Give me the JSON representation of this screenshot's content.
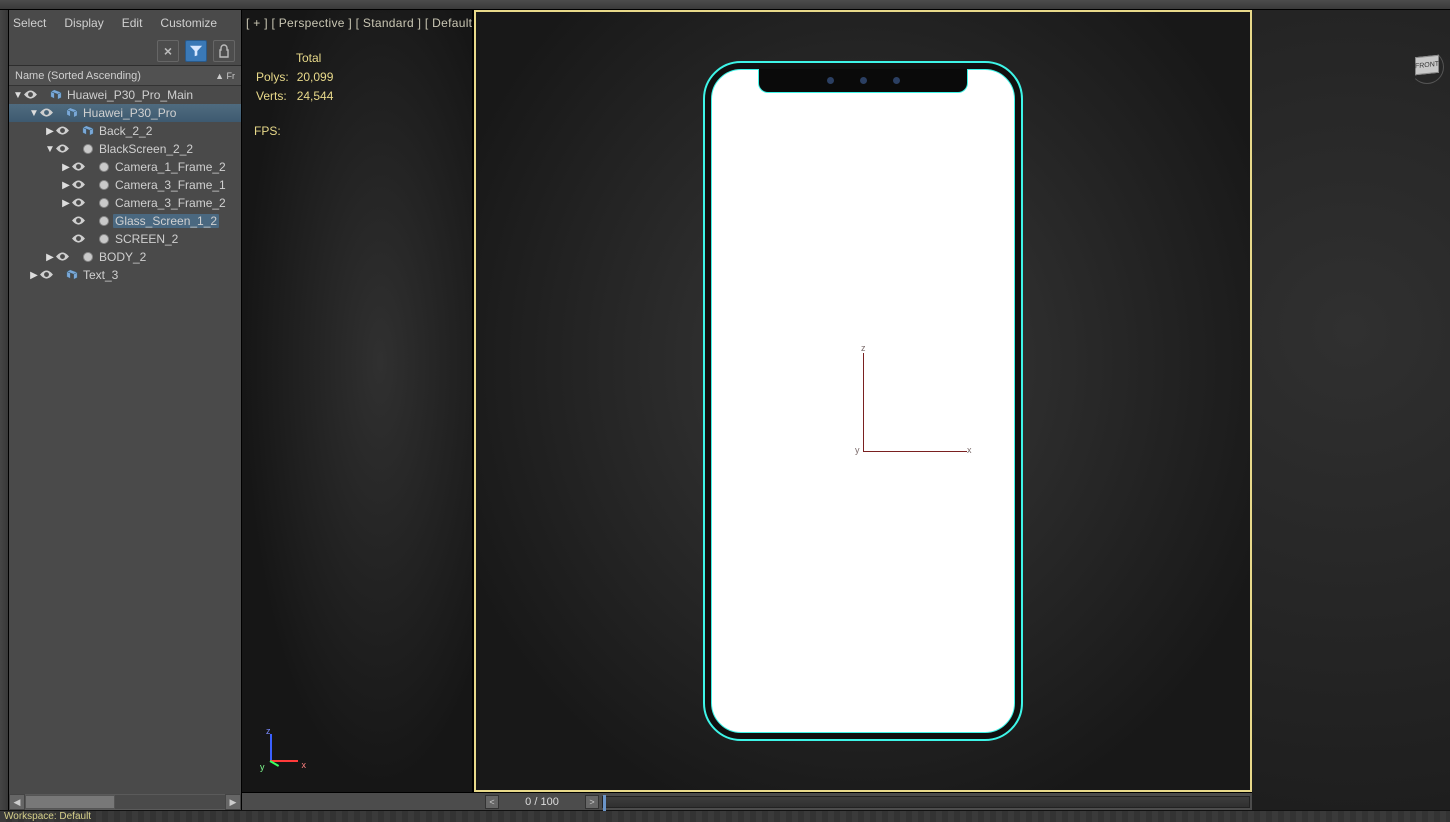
{
  "toolbar_icons": 20,
  "outliner": {
    "menus": [
      "Select",
      "Display",
      "Edit",
      "Customize"
    ],
    "header_label": "Name (Sorted Ascending)",
    "header_col2": "Fr",
    "items": [
      {
        "ind": 0,
        "tog": "▼",
        "kind": "group",
        "label": "Huawei_P30_Pro_Main",
        "sel": false
      },
      {
        "ind": 1,
        "tog": "▼",
        "kind": "group",
        "label": "Huawei_P30_Pro",
        "sel": true
      },
      {
        "ind": 2,
        "tog": "▶",
        "kind": "group",
        "label": "Back_2_2",
        "sel": false
      },
      {
        "ind": 2,
        "tog": "▼",
        "kind": "geom",
        "label": "BlackScreen_2_2",
        "sel": false
      },
      {
        "ind": 3,
        "tog": "▶",
        "kind": "geom",
        "label": "Camera_1_Frame_2",
        "sel": false
      },
      {
        "ind": 3,
        "tog": "▶",
        "kind": "geom",
        "label": "Camera_3_Frame_1",
        "sel": false
      },
      {
        "ind": 3,
        "tog": "▶",
        "kind": "geom",
        "label": "Camera_3_Frame_2",
        "sel": false
      },
      {
        "ind": 3,
        "tog": "",
        "kind": "geom",
        "label": "Glass_Screen_1_2",
        "sel": false,
        "lblsel": true
      },
      {
        "ind": 3,
        "tog": "",
        "kind": "geom",
        "label": "SCREEN_2",
        "sel": false
      },
      {
        "ind": 2,
        "tog": "▶",
        "kind": "geom",
        "label": "BODY_2",
        "sel": false
      },
      {
        "ind": 1,
        "tog": "▶",
        "kind": "group",
        "label": "Text_3",
        "sel": false
      }
    ]
  },
  "viewport": {
    "label": "[ + ] [ Perspective ] [ Standard ] [ Default Shading ]",
    "stats_header": "Total",
    "polys_label": "Polys:",
    "polys_value": "20,099",
    "verts_label": "Verts:",
    "verts_value": "24,544",
    "fps_label": "FPS:",
    "axis": {
      "x": "x",
      "y": "y",
      "z": "z"
    },
    "viewcube_face": "FRONT"
  },
  "timeline": {
    "pos": "0 / 100"
  },
  "workspace_label": "Workspace: Default"
}
